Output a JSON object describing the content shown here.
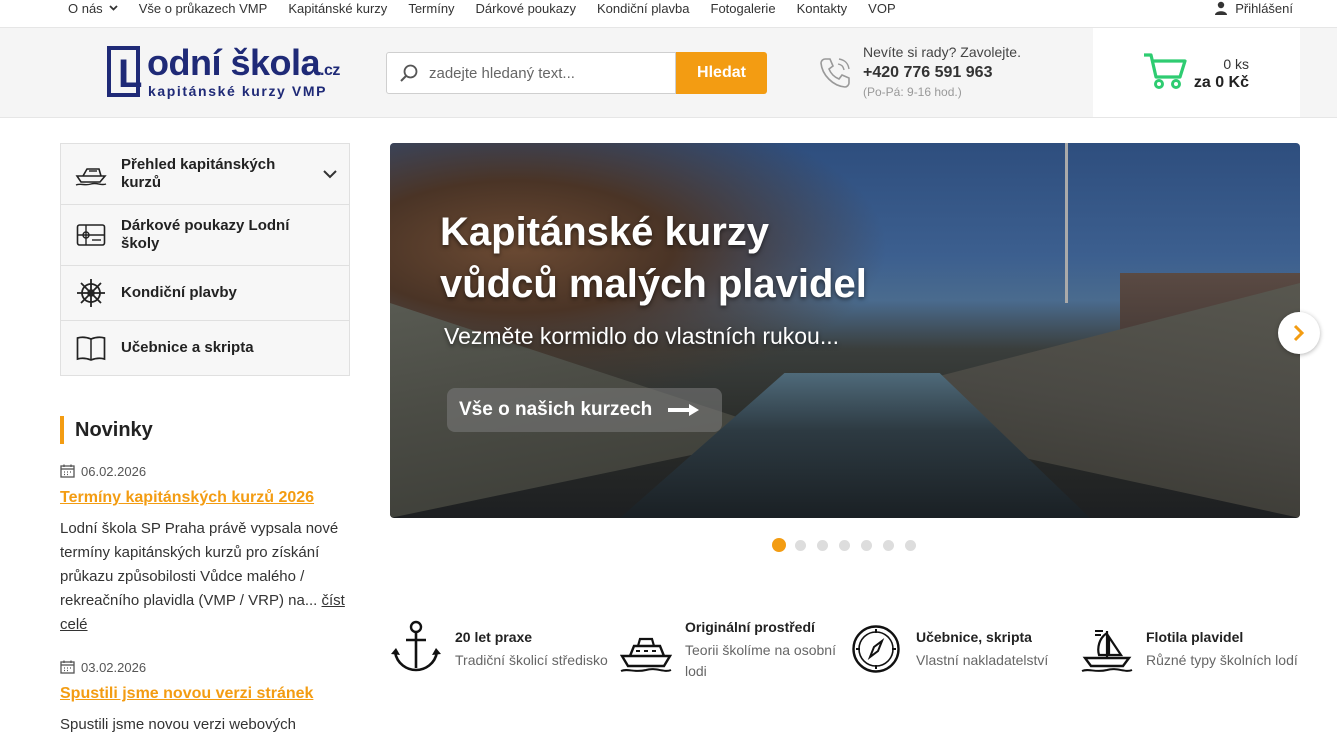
{
  "topnav": {
    "items": [
      "O nás",
      "Vše o průkazech VMP",
      "Kapitánské kurzy",
      "Termíny",
      "Dárkové poukazy",
      "Kondiční plavba",
      "Fotogalerie",
      "Kontakty",
      "VOP"
    ],
    "login": "Přihlášení"
  },
  "logo": {
    "letter": "L",
    "name": "odní škola",
    "tld": ".cz",
    "tagline": "kapitánské kurzy VMP"
  },
  "search": {
    "placeholder": "zadejte hledaný text...",
    "button": "Hledat"
  },
  "contact": {
    "question": "Nevíte si rady? Zavolejte.",
    "phone": "+420 776 591 963",
    "hours": "(Po-Pá: 9-16 hod.)"
  },
  "cart": {
    "count": "0 ks",
    "total": "za 0 Kč"
  },
  "sidemenu": {
    "items": [
      {
        "label": "Přehled kapitánských kurzů",
        "icon": "boat-icon"
      },
      {
        "label": "Dárkové poukazy Lodní školy",
        "icon": "gift-card-icon"
      },
      {
        "label": "Kondiční plavby",
        "icon": "ship-wheel-icon"
      },
      {
        "label": "Učebnice a skripta",
        "icon": "book-icon"
      }
    ]
  },
  "news": {
    "heading": "Novinky",
    "items": [
      {
        "date": "06.02.2026",
        "title": "Termíny kapitánských kurzů 2026",
        "text": "Lodní škola SP Praha právě vypsala nové termíny kapitánských kurzů pro získání průkazu způsobilosti Vůdce malého / rekreačního plavidla (VMP / VRP) na... ",
        "more": "číst celé"
      },
      {
        "date": "03.02.2026",
        "title": "Spustili jsme novou verzi stránek",
        "text": "Spustili jsme novou verzi webových"
      }
    ]
  },
  "hero": {
    "title_line1": "Kapitánské kurzy",
    "title_line2": "vůdců malých plavidel",
    "subtitle": "Vezměte kormidlo do vlastních rukou...",
    "cta": "Vše o našich kurzech",
    "slides_total": 7,
    "active_slide": 1
  },
  "features": [
    {
      "title": "20 let praxe",
      "desc1": "Tradiční školicí středisko",
      "desc2": "",
      "icon": "anchor-icon"
    },
    {
      "title": "Originální prostředí",
      "desc1": "Teorii školíme na osobní",
      "desc2": "lodi",
      "icon": "ship-icon"
    },
    {
      "title": "Učebnice, skripta",
      "desc1": "Vlastní nakladatelství",
      "desc2": "",
      "icon": "compass-icon"
    },
    {
      "title": "Flotila plavidel",
      "desc1": "Různé typy školních lodí",
      "desc2": "",
      "icon": "sailboat-icon"
    }
  ],
  "colors": {
    "accent": "#f39c12",
    "brand": "#1f2a77",
    "cart": "#2ecc71"
  }
}
